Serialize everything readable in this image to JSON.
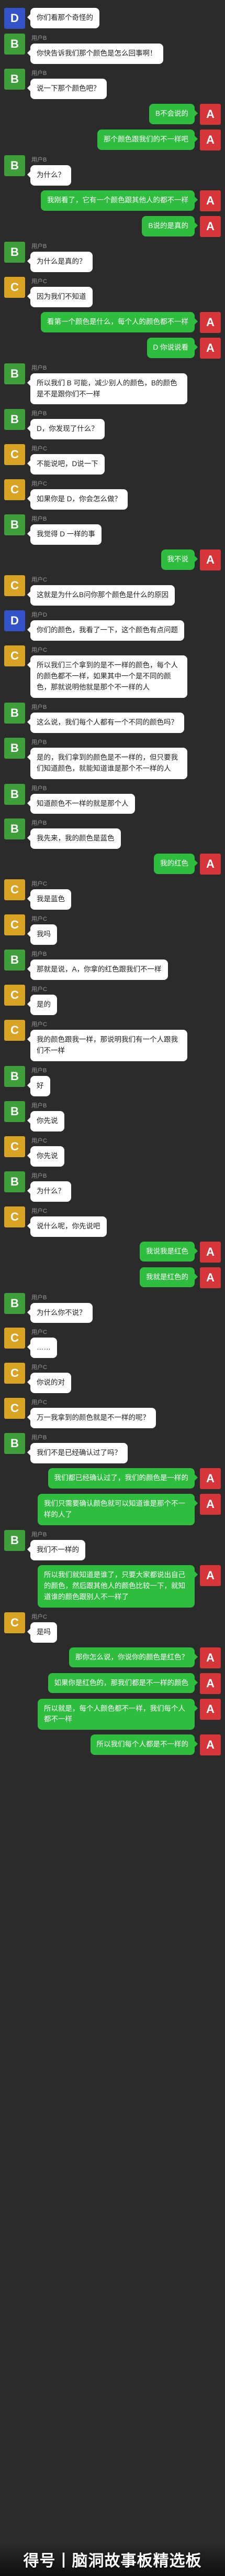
{
  "colors": {
    "background": "#2b2b2b",
    "bubble_in": "#ffffff",
    "bubble_out": "#2fbd3f",
    "avatar_B": "#3f9f3a",
    "avatar_C": "#d9a324",
    "avatar_D": "#3553c9",
    "avatar_A": "#d6363a"
  },
  "users": {
    "A": {
      "letter": "A",
      "name": ""
    },
    "B": {
      "letter": "B",
      "name": "用户B"
    },
    "C": {
      "letter": "C",
      "name": "用户C"
    },
    "D": {
      "letter": "D",
      "name": "用户D"
    }
  },
  "messages": [
    {
      "user": "D",
      "side": "left",
      "show_name": false,
      "text": "你们看那个奇怪的"
    },
    {
      "user": "B",
      "side": "left",
      "show_name": true,
      "text": "你快告诉我们那个颜色是怎么回事啊！"
    },
    {
      "user": "B",
      "side": "left",
      "show_name": true,
      "text": "说一下那个颜色吧？"
    },
    {
      "user": "A",
      "side": "right",
      "show_name": false,
      "text": "B不会说的"
    },
    {
      "user": "A",
      "side": "right",
      "show_name": false,
      "text": "那个颜色跟我们的不一样吧"
    },
    {
      "user": "B",
      "side": "left",
      "show_name": true,
      "text": "为什么？"
    },
    {
      "user": "A",
      "side": "right",
      "show_name": false,
      "text": "我刚看了，它有一个颜色跟其他人的都不一样"
    },
    {
      "user": "A",
      "side": "right",
      "show_name": false,
      "text": "B说的是真的"
    },
    {
      "user": "B",
      "side": "left",
      "show_name": true,
      "text": "为什么是真的？"
    },
    {
      "user": "C",
      "side": "left",
      "show_name": true,
      "text": "因为我们不知道"
    },
    {
      "user": "A",
      "side": "right",
      "show_name": false,
      "text": "看第一个颜色是什么，每个人的颜色都不一样"
    },
    {
      "user": "A",
      "side": "right",
      "show_name": false,
      "text": "D 你说说看"
    },
    {
      "user": "B",
      "side": "left",
      "show_name": true,
      "text": "所以我们 B 可能，减少别人的颜色，B的颜色是不是跟你们不一样"
    },
    {
      "user": "B",
      "side": "left",
      "show_name": true,
      "text": "D，你发现了什么？"
    },
    {
      "user": "C",
      "side": "left",
      "show_name": true,
      "text": "不能说吧，D说一下"
    },
    {
      "user": "C",
      "side": "left",
      "show_name": true,
      "text": "如果你是 D，你会怎么做？"
    },
    {
      "user": "B",
      "side": "left",
      "show_name": true,
      "text": "我觉得 D 一样的事"
    },
    {
      "user": "A",
      "side": "right",
      "show_name": false,
      "text": "我不说"
    },
    {
      "user": "C",
      "side": "left",
      "show_name": true,
      "text": "这就是为什么B问你那个颜色是什么的原因"
    },
    {
      "user": "D",
      "side": "left",
      "show_name": true,
      "text": "你们的颜色，我看了一下，这个颜色有点问题"
    },
    {
      "user": "C",
      "side": "left",
      "show_name": true,
      "text": "所以我们三个拿到的是不一样的颜色，每个人的颜色都不一样，如果其中一个是不同的颜色，那就说明他就是那个不一样的人"
    },
    {
      "user": "B",
      "side": "left",
      "show_name": true,
      "text": "这么说，我们每个人都有一个不同的颜色吗？"
    },
    {
      "user": "B",
      "side": "left",
      "show_name": true,
      "text": "是的，我们拿到的颜色是不一样的，但只要我们知道颜色，就能知道谁是那个不一样的人"
    },
    {
      "user": "B",
      "side": "left",
      "show_name": true,
      "text": "知道颜色不一样的就是那个人"
    },
    {
      "user": "B",
      "side": "left",
      "show_name": true,
      "text": "我先来，我的颜色是蓝色"
    },
    {
      "user": "A",
      "side": "right",
      "show_name": false,
      "text": "我的红色"
    },
    {
      "user": "C",
      "side": "left",
      "show_name": true,
      "text": "我是蓝色"
    },
    {
      "user": "C",
      "side": "left",
      "show_name": true,
      "text": "我吗"
    },
    {
      "user": "B",
      "side": "left",
      "show_name": true,
      "text": "那就是说，A，你拿的红色跟我们不一样"
    },
    {
      "user": "C",
      "side": "left",
      "show_name": true,
      "text": "是的"
    },
    {
      "user": "C",
      "side": "left",
      "show_name": true,
      "text": "我的颜色跟我一样，那说明我们有一个人跟我们不一样"
    },
    {
      "user": "B",
      "side": "left",
      "show_name": true,
      "text": "好"
    },
    {
      "user": "B",
      "side": "left",
      "show_name": true,
      "text": "你先说"
    },
    {
      "user": "C",
      "side": "left",
      "show_name": true,
      "text": "你先说"
    },
    {
      "user": "B",
      "side": "left",
      "show_name": true,
      "text": "为什么？"
    },
    {
      "user": "C",
      "side": "left",
      "show_name": true,
      "text": "说什么呢，你先说吧"
    },
    {
      "user": "A",
      "side": "right",
      "show_name": false,
      "text": "我说我是红色"
    },
    {
      "user": "A",
      "side": "right",
      "show_name": false,
      "text": "我就是红色的"
    },
    {
      "user": "B",
      "side": "left",
      "show_name": true,
      "text": "为什么你不说？"
    },
    {
      "user": "C",
      "side": "left",
      "show_name": true,
      "text": "……"
    },
    {
      "user": "C",
      "side": "left",
      "show_name": true,
      "text": "你说的对"
    },
    {
      "user": "C",
      "side": "left",
      "show_name": true,
      "text": "万一我拿到的颜色就是不一样的呢？"
    },
    {
      "user": "B",
      "side": "left",
      "show_name": true,
      "text": "我们不是已经确认过了吗？"
    },
    {
      "user": "A",
      "side": "right",
      "show_name": false,
      "text": "我们都已经确认过了，我们的颜色是一样的"
    },
    {
      "user": "A",
      "side": "right",
      "show_name": false,
      "text": "我们只需要确认颜色就可以知道谁是那个不一样的人了"
    },
    {
      "user": "B",
      "side": "left",
      "show_name": true,
      "text": "我们不一样的"
    },
    {
      "user": "A",
      "side": "right",
      "show_name": false,
      "text": "所以我们就知道是谁了，只要大家都说出自己的颜色，然后跟其他人的颜色比较一下，就知道谁的颜色跟别人不一样了"
    },
    {
      "user": "C",
      "side": "left",
      "show_name": true,
      "text": "是吗"
    },
    {
      "user": "A",
      "side": "right",
      "show_name": false,
      "text": "那你怎么说，你说你的颜色是红色？"
    },
    {
      "user": "A",
      "side": "right",
      "show_name": false,
      "text": "如果你是红色的，那我们都是不一样的颜色"
    },
    {
      "user": "A",
      "side": "right",
      "show_name": false,
      "text": "所以就是，每个人颜色都不一样，我们每个人都不一样"
    },
    {
      "user": "A",
      "side": "right",
      "show_name": false,
      "text": "所以我们每个人都是不一样的"
    }
  ],
  "watermark": {
    "text": "得号丨脑洞故事板精选板"
  }
}
